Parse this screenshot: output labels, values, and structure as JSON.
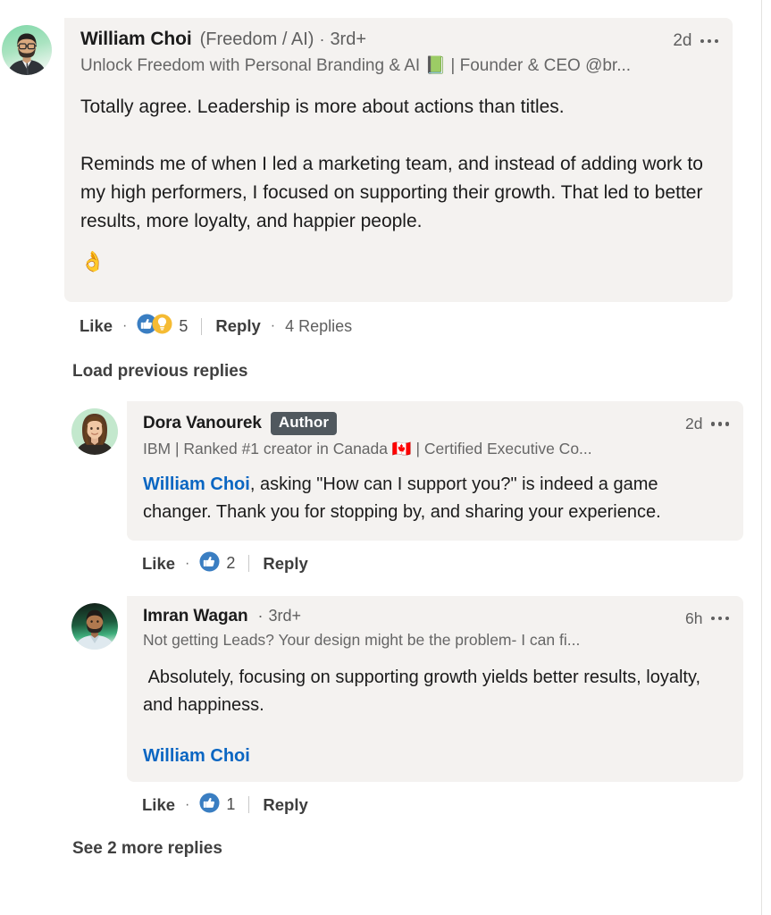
{
  "colors": {
    "bubble_bg": "#f4f2f0",
    "page_bg": "#ffffff",
    "link_blue": "#0a66c2",
    "author_badge_bg": "#50585e",
    "text_primary": "#1b1b1b",
    "text_secondary": "#666666",
    "reaction_like_blue": "#3a7ec2",
    "reaction_insight_yellow": "#f5bb33"
  },
  "comment": {
    "author_name": "William Choi",
    "author_suffix": "(Freedom / AI)",
    "separator": "·",
    "degree": "3rd+",
    "headline": "Unlock Freedom with Personal Branding & AI 📗 | Founder & CEO @br...",
    "timestamp": "2d",
    "more_icon": "ellipsis-icon",
    "body_paragraph_1": "Totally agree. Leadership is more about actions than titles.",
    "body_paragraph_2": "Reminds me of when I led a marketing team, and instead of adding work to my high performers, I focused on supporting their growth. That led to better results, more loyalty, and happier people.",
    "reaction_emoji": "👌",
    "actions": {
      "like_label": "Like",
      "dot": "·",
      "reaction_count": "5",
      "reaction_icons": [
        "like-thumb-icon",
        "insightful-bulb-icon"
      ],
      "reply_label": "Reply",
      "replies_label": "4 Replies"
    }
  },
  "load_previous": {
    "label": "Load previous replies"
  },
  "replies": [
    {
      "author_name": "Dora Vanourek",
      "badge": "Author",
      "degree": "",
      "headline": "IBM | Ranked #1 creator in Canada 🇨🇦 | Certified Executive Co...",
      "timestamp": "2d",
      "more_icon": "ellipsis-icon",
      "mention": "William Choi",
      "body": ", asking \"How can I support you?\" is indeed a game changer. Thank you for stopping by, and sharing your experience.",
      "actions": {
        "like_label": "Like",
        "dot": "·",
        "reaction_count": "2",
        "reaction_icons": [
          "like-thumb-icon"
        ],
        "reply_label": "Reply"
      }
    },
    {
      "author_name": "Imran Wagan",
      "badge": "",
      "degree": "3rd+",
      "separator": "·",
      "headline": "Not getting Leads? Your design might be the problem- I can fi...",
      "timestamp": "6h",
      "more_icon": "ellipsis-icon",
      "body": " Absolutely, focusing on supporting growth yields better results, loyalty, and happiness.",
      "mention_block": "William Choi",
      "actions": {
        "like_label": "Like",
        "dot": "·",
        "reaction_count": "1",
        "reaction_icons": [
          "like-thumb-icon"
        ],
        "reply_label": "Reply"
      }
    }
  ],
  "see_more": {
    "label": "See 2 more replies"
  }
}
